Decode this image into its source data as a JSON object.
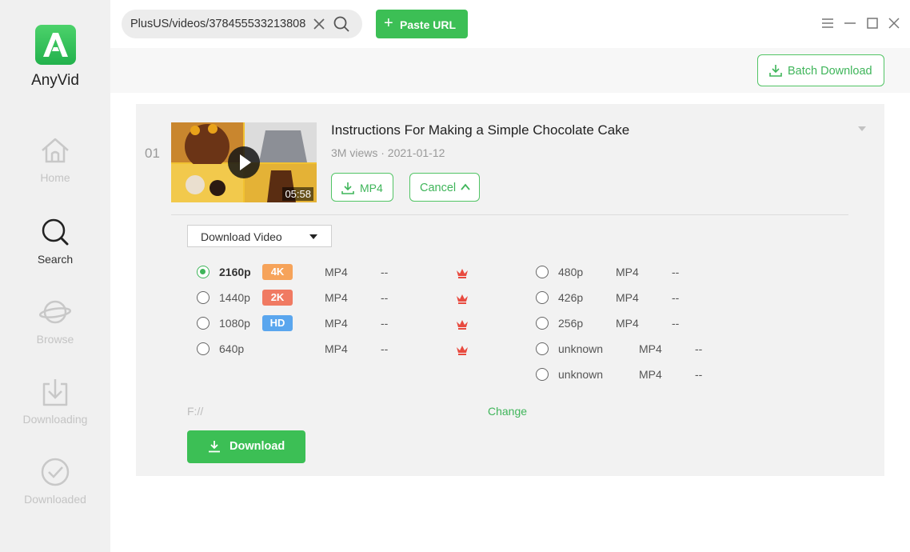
{
  "app": {
    "name": "AnyVid"
  },
  "sidebar": {
    "items": [
      {
        "label": "Home",
        "icon": "home-icon",
        "active": false
      },
      {
        "label": "Search",
        "icon": "search-icon",
        "active": true
      },
      {
        "label": "Browse",
        "icon": "planet-icon",
        "active": false
      },
      {
        "label": "Downloading",
        "icon": "download-icon",
        "active": false
      },
      {
        "label": "Downloaded",
        "icon": "check-circle-icon",
        "active": false
      }
    ]
  },
  "topbar": {
    "url_value": "PlusUS/videos/378455533213808",
    "paste_label": "Paste URL"
  },
  "toolbar": {
    "batch_label": "Batch Download"
  },
  "video": {
    "index": "01",
    "title": "Instructions For Making a Simple Chocolate Cake",
    "meta": "3M views · 2021-01-12",
    "duration": "05:58",
    "format_btn": "MP4",
    "cancel_btn": "Cancel"
  },
  "download_panel": {
    "mode": "Download Video",
    "left_options": [
      {
        "res": "2160p",
        "badge": "4K",
        "badge_color": "#f6a35a",
        "format": "MP4",
        "size": "--",
        "premium": true,
        "selected": true
      },
      {
        "res": "1440p",
        "badge": "2K",
        "badge_color": "#f07a62",
        "format": "MP4",
        "size": "--",
        "premium": true,
        "selected": false
      },
      {
        "res": "1080p",
        "badge": "HD",
        "badge_color": "#5aa6ee",
        "format": "MP4",
        "size": "--",
        "premium": true,
        "selected": false
      },
      {
        "res": "640p",
        "badge": "",
        "badge_color": "",
        "format": "MP4",
        "size": "--",
        "premium": true,
        "selected": false
      }
    ],
    "right_options": [
      {
        "res": "480p",
        "format": "MP4",
        "size": "--"
      },
      {
        "res": "426p",
        "format": "MP4",
        "size": "--"
      },
      {
        "res": "256p",
        "format": "MP4",
        "size": "--"
      },
      {
        "res": "unknown",
        "format": "MP4",
        "size": "--"
      },
      {
        "res": "unknown",
        "format": "MP4",
        "size": "--"
      }
    ],
    "path": "F://",
    "change_label": "Change",
    "download_label": "Download"
  },
  "colors": {
    "accent": "#3cbf55",
    "premium": "#e84a3f"
  }
}
